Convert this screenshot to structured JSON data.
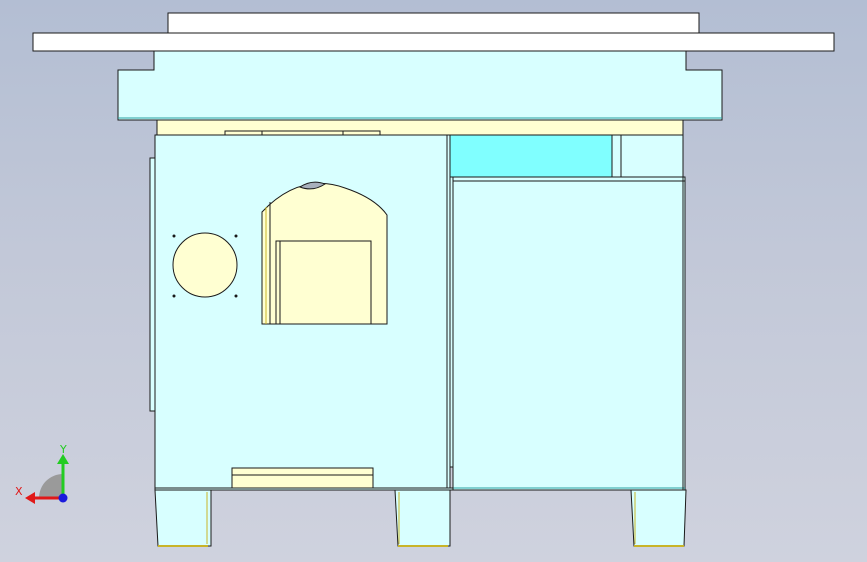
{
  "viewport": {
    "background_top": "#b3bed3",
    "background_bottom": "#cfd2de"
  },
  "colors": {
    "face_cyan": "#d8ffff",
    "face_cream": "#ffffd2",
    "face_bright_cyan": "#80ffff",
    "face_gray": "#a8b0bc",
    "edge": "#1a1a1a",
    "edge_yellow": "#c8b428",
    "edge_teal": "#28a0a0"
  },
  "triad": {
    "y_label": "Y",
    "x_label": "X",
    "y_color": "#22cc22",
    "x_color": "#e01818",
    "z_color": "#1a1adc"
  }
}
